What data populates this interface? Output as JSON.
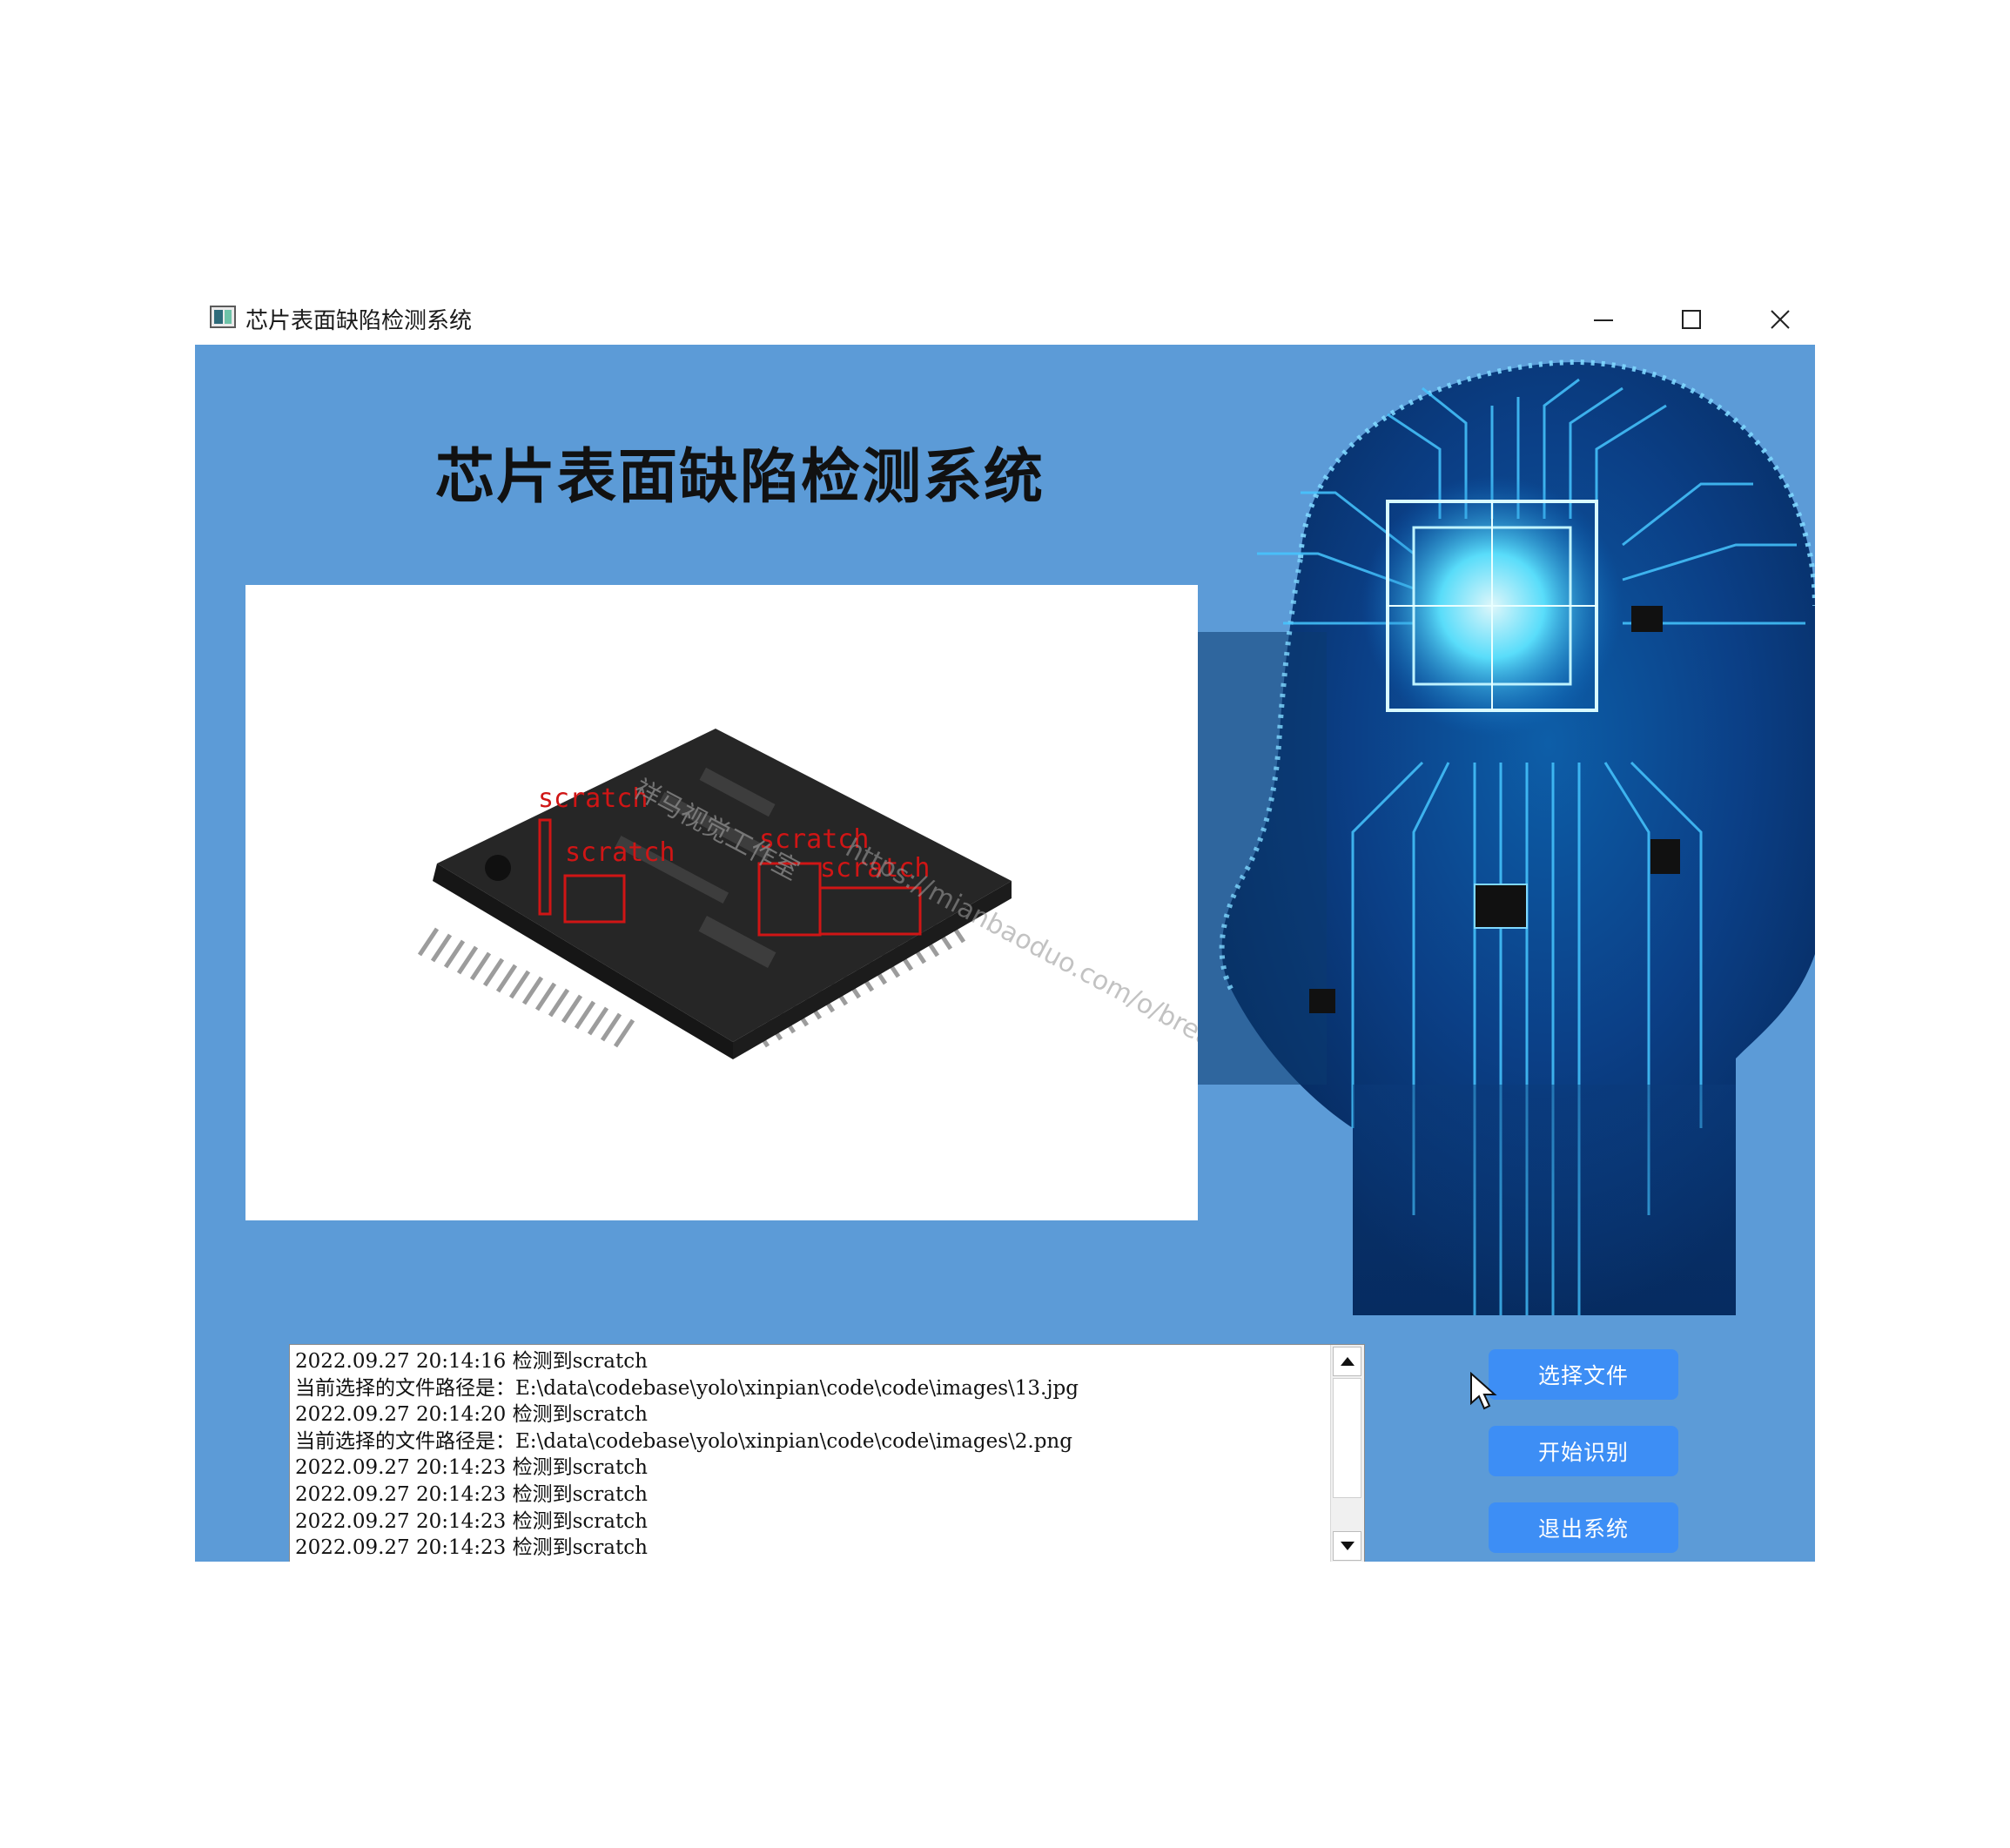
{
  "window": {
    "title": "芯片表面缺陷检测系统",
    "controls": {
      "minimize": "minimize-icon",
      "maximize": "maximize-icon",
      "close": "close-icon"
    }
  },
  "main": {
    "heading": "芯片表面缺陷检测系统",
    "image_panel": {
      "detections": [
        "scratch",
        "scratch",
        "scratch",
        "scratch"
      ],
      "watermark_text_1": "祥马视觉工作室",
      "watermark_text_2": "https://mianbaoduo.com/o/bread/xunshan/work"
    },
    "log_lines": [
      "2022.09.27 20:14:16 检测到scratch",
      "当前选择的文件路径是：E:\\data\\codebase\\yolo\\xinpian\\code\\code\\images\\13.jpg",
      "2022.09.27 20:14:20 检测到scratch",
      "当前选择的文件路径是：E:\\data\\codebase\\yolo\\xinpian\\code\\code\\images\\2.png",
      "2022.09.27 20:14:23 检测到scratch",
      "2022.09.27 20:14:23 检测到scratch",
      "2022.09.27 20:14:23 检测到scratch",
      "2022.09.27 20:14:23 检测到scratch"
    ],
    "buttons": {
      "select_file": "选择文件",
      "start_recognition": "开始识别",
      "exit_system": "退出系统"
    }
  },
  "colors": {
    "background_blue": "#5c9bd7",
    "button_blue": "#3d8ef5",
    "detection_red": "#d01515"
  }
}
